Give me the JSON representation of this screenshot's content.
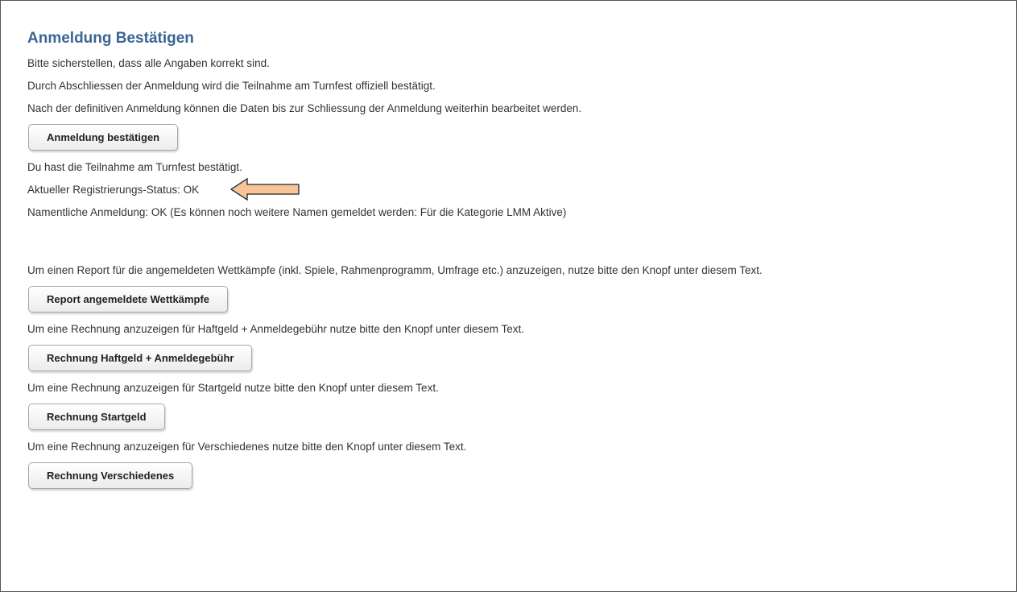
{
  "page": {
    "title": "Anmeldung Bestätigen",
    "intro_lines": [
      "Bitte sicherstellen, dass alle Angaben korrekt sind.",
      "Durch Abschliessen der Anmeldung wird die Teilnahme am Turnfest offiziell bestätigt.",
      "Nach der definitiven Anmeldung können die Daten bis zur Schliessung der Anmeldung weiterhin bearbeitet werden."
    ],
    "confirm_button": "Anmeldung bestätigen",
    "confirmed_text": "Du hast die Teilnahme am Turnfest bestätigt.",
    "registration_status": "Aktueller Registrierungs-Status: OK",
    "named_registration": "Namentliche Anmeldung: OK (Es können noch weitere Namen gemeldet werden: Für die Kategorie LMM Aktive)",
    "report_text": "Um einen Report für die angemeldeten Wettkämpfe (inkl. Spiele, Rahmenprogramm, Umfrage etc.) anzuzeigen, nutze bitte den Knopf unter diesem Text.",
    "report_button": "Report angemeldete Wettkämpfe",
    "invoice_haftgeld_text": "Um eine Rechnung anzuzeigen für Haftgeld + Anmeldegebühr nutze bitte den Knopf unter diesem Text.",
    "invoice_haftgeld_button": "Rechnung Haftgeld + Anmeldegebühr",
    "invoice_startgeld_text": "Um eine Rechnung anzuzeigen für Startgeld nutze bitte den Knopf unter diesem Text.",
    "invoice_startgeld_button": "Rechnung Startgeld",
    "invoice_misc_text": "Um eine Rechnung anzuzeigen für Verschiedenes nutze bitte den Knopf unter diesem Text.",
    "invoice_misc_button": "Rechnung Verschiedenes"
  },
  "colors": {
    "title": "#3b6592",
    "arrow_fill": "#f8c49a",
    "arrow_stroke": "#222222"
  },
  "icons": {
    "annotation": "left-arrow-icon"
  }
}
